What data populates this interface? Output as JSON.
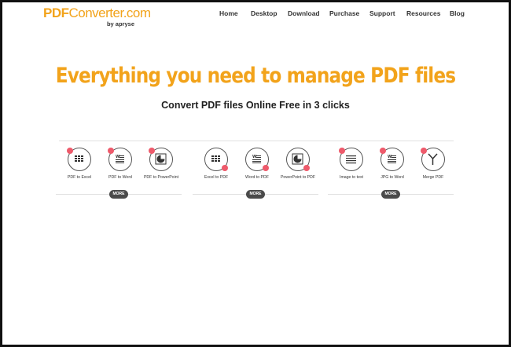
{
  "logo": {
    "pdf": "PDF",
    "rest": "Converter.com",
    "sub": "by apryse"
  },
  "nav": [
    "Home",
    "Desktop",
    "Download",
    "Purchase",
    "Support",
    "Resources",
    "Blog"
  ],
  "hero": {
    "title": "Everything you need to manage PDF files",
    "subtitle": "Convert PDF files Online Free in 3 clicks"
  },
  "colors": {
    "accent": "#f2a31b",
    "badge": "#ee5a6b",
    "more": "#4a4a4a"
  },
  "groups": [
    {
      "more": "MORE",
      "tools": [
        {
          "label": "PDF to Excel",
          "icon": "grid-icon"
        },
        {
          "label": "PDF to Word",
          "icon": "document-icon"
        },
        {
          "label": "PDF to PowerPoint",
          "icon": "pie-chart-icon"
        }
      ]
    },
    {
      "more": "MORE",
      "tools": [
        {
          "label": "Excel to PDF",
          "icon": "grid-icon"
        },
        {
          "label": "Word to PDF",
          "icon": "document-icon"
        },
        {
          "label": "PowerPoint to PDF",
          "icon": "pie-chart-icon"
        }
      ]
    },
    {
      "more": "MORE",
      "tools": [
        {
          "label": "Image to text",
          "icon": "text-lines-icon"
        },
        {
          "label": "JPG to Word",
          "icon": "document-icon"
        },
        {
          "label": "Merge PDF",
          "icon": "merge-icon"
        }
      ]
    }
  ]
}
